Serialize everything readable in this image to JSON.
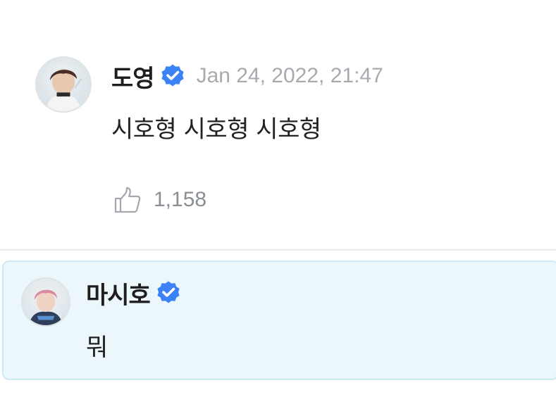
{
  "comment": {
    "author": "도영",
    "timestamp": "Jan 24, 2022, 21:47",
    "text": "시호형 시호형 시호형",
    "likes": "1,158"
  },
  "reply": {
    "author": "마시호",
    "text": "뭐"
  },
  "colors": {
    "verified_badge": "#3b82f6",
    "reply_background": "#ecf7fc",
    "reply_border": "#cfe9f3",
    "timestamp": "#a7abb0"
  },
  "icons": {
    "verified": "verified-badge-icon",
    "like": "thumbs-up-icon"
  }
}
